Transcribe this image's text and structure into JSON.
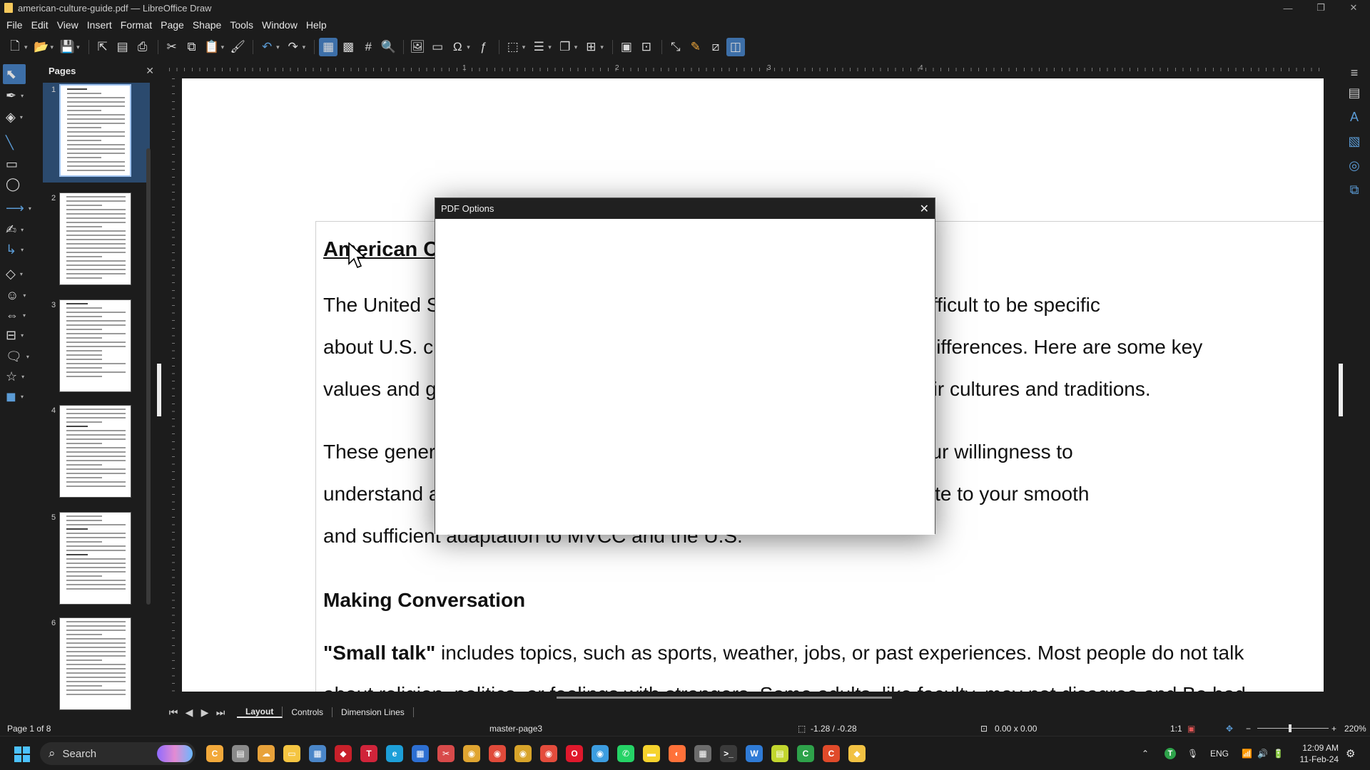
{
  "window": {
    "title": "american-culture-guide.pdf — LibreOffice Draw",
    "controls": [
      "—",
      "❐",
      "✕"
    ]
  },
  "menu": [
    "File",
    "Edit",
    "View",
    "Insert",
    "Format",
    "Page",
    "Shape",
    "Tools",
    "Window",
    "Help"
  ],
  "pages_panel": {
    "title": "Pages",
    "close": "✕",
    "page_numbers": [
      "1",
      "2",
      "3",
      "4",
      "5",
      "6"
    ]
  },
  "ruler": {
    "numbers": [
      "1",
      "2",
      "3",
      "4"
    ]
  },
  "document": {
    "heading": "American Culture Guide",
    "para1_line1": "The United States is a country of many cultures and traditions. It is difficult to be specific",
    "para1_line2": "about U.S. customs because of the many regional and generational differences. Here are some key",
    "para1_line3": "values and generalizations about people in the United States and their cultures and traditions.",
    "para2_line1": "These generalizations can help you on the path to understanding. Your willingness to",
    "para2_line2": "understand and adapt to the differences of others will greatly contribute to your smooth",
    "para2_line3": "and sufficient adaptation to MVCC and the U.S.",
    "section_heading": "Making Conversation",
    "para3_bold": "\"Small talk\"",
    "para3_rest": " includes topics, such as sports, weather, jobs, or past experiences. Most people do not talk",
    "para3_line2": "about religion, politics, or feelings with strangers. Some adults, like faculty, may not disagree and Bo bad"
  },
  "dialog": {
    "title": "PDF Options",
    "close": "✕"
  },
  "tabs": {
    "nav": [
      "⏮",
      "◀",
      "▶",
      "⏭"
    ],
    "items": [
      "Layout",
      "Controls",
      "Dimension Lines"
    ],
    "active": "Layout"
  },
  "status": {
    "page": "Page 1 of 8",
    "master": "master-page3",
    "position": "-1.28 / -0.28",
    "size": "0.00 x 0.00",
    "scale": "1:1",
    "zoom": "220%"
  },
  "taskbar": {
    "search_placeholder": "Search",
    "lang": "ENG",
    "time": "12:09 AM",
    "date": "11-Feb-24",
    "apps": [
      {
        "name": "app-copilot",
        "color": "#f2a93b",
        "glyph": "C"
      },
      {
        "name": "app-files-gray",
        "color": "#8a8a8a",
        "glyph": "▤"
      },
      {
        "name": "app-weather",
        "color": "#e8a23a",
        "glyph": "☁"
      },
      {
        "name": "app-explorer",
        "color": "#f5c542",
        "glyph": "▭"
      },
      {
        "name": "app-photos",
        "color": "#4a86c8",
        "glyph": "▦"
      },
      {
        "name": "app-red",
        "color": "#c8202a",
        "glyph": "◆"
      },
      {
        "name": "app-t",
        "color": "#d0243a",
        "glyph": "T"
      },
      {
        "name": "app-edge",
        "color": "#1d9fd8",
        "glyph": "e"
      },
      {
        "name": "app-calc-blue",
        "color": "#2d6fd2",
        "glyph": "▦"
      },
      {
        "name": "app-snip",
        "color": "#d84a4a",
        "glyph": "✂"
      },
      {
        "name": "app-chrome1",
        "color": "#e0a531",
        "glyph": "◉"
      },
      {
        "name": "app-chrome2",
        "color": "#e04a3a",
        "glyph": "◉"
      },
      {
        "name": "app-chrome3",
        "color": "#d8a42a",
        "glyph": "◉"
      },
      {
        "name": "app-chrome4",
        "color": "#e44c3c",
        "glyph": "◉"
      },
      {
        "name": "app-opera",
        "color": "#e0182c",
        "glyph": "O"
      },
      {
        "name": "app-chrome5",
        "color": "#3c9de0",
        "glyph": "◉"
      },
      {
        "name": "app-whatsapp",
        "color": "#25d366",
        "glyph": "✆"
      },
      {
        "name": "app-sticky",
        "color": "#f6d32d",
        "glyph": "▬"
      },
      {
        "name": "app-firefox",
        "color": "#ff7139",
        "glyph": "◐"
      },
      {
        "name": "app-calculator",
        "color": "#6c6c6c",
        "glyph": "▦"
      },
      {
        "name": "app-terminal",
        "color": "#3a3a3a",
        "glyph": ">_"
      },
      {
        "name": "app-writer",
        "color": "#2f7bd6",
        "glyph": "W"
      },
      {
        "name": "app-calc-green",
        "color": "#c2d62e",
        "glyph": "▤"
      },
      {
        "name": "app-calc-lo",
        "color": "#2ea24a",
        "glyph": "C"
      },
      {
        "name": "app-impress",
        "color": "#e04a2a",
        "glyph": "C"
      },
      {
        "name": "app-draw",
        "color": "#f2c243",
        "glyph": "◆"
      }
    ]
  },
  "colors": {
    "accent": "#3d6fa8",
    "dialog_header": "#202020",
    "page": "#ffffff",
    "background": "#1c1c1c"
  }
}
